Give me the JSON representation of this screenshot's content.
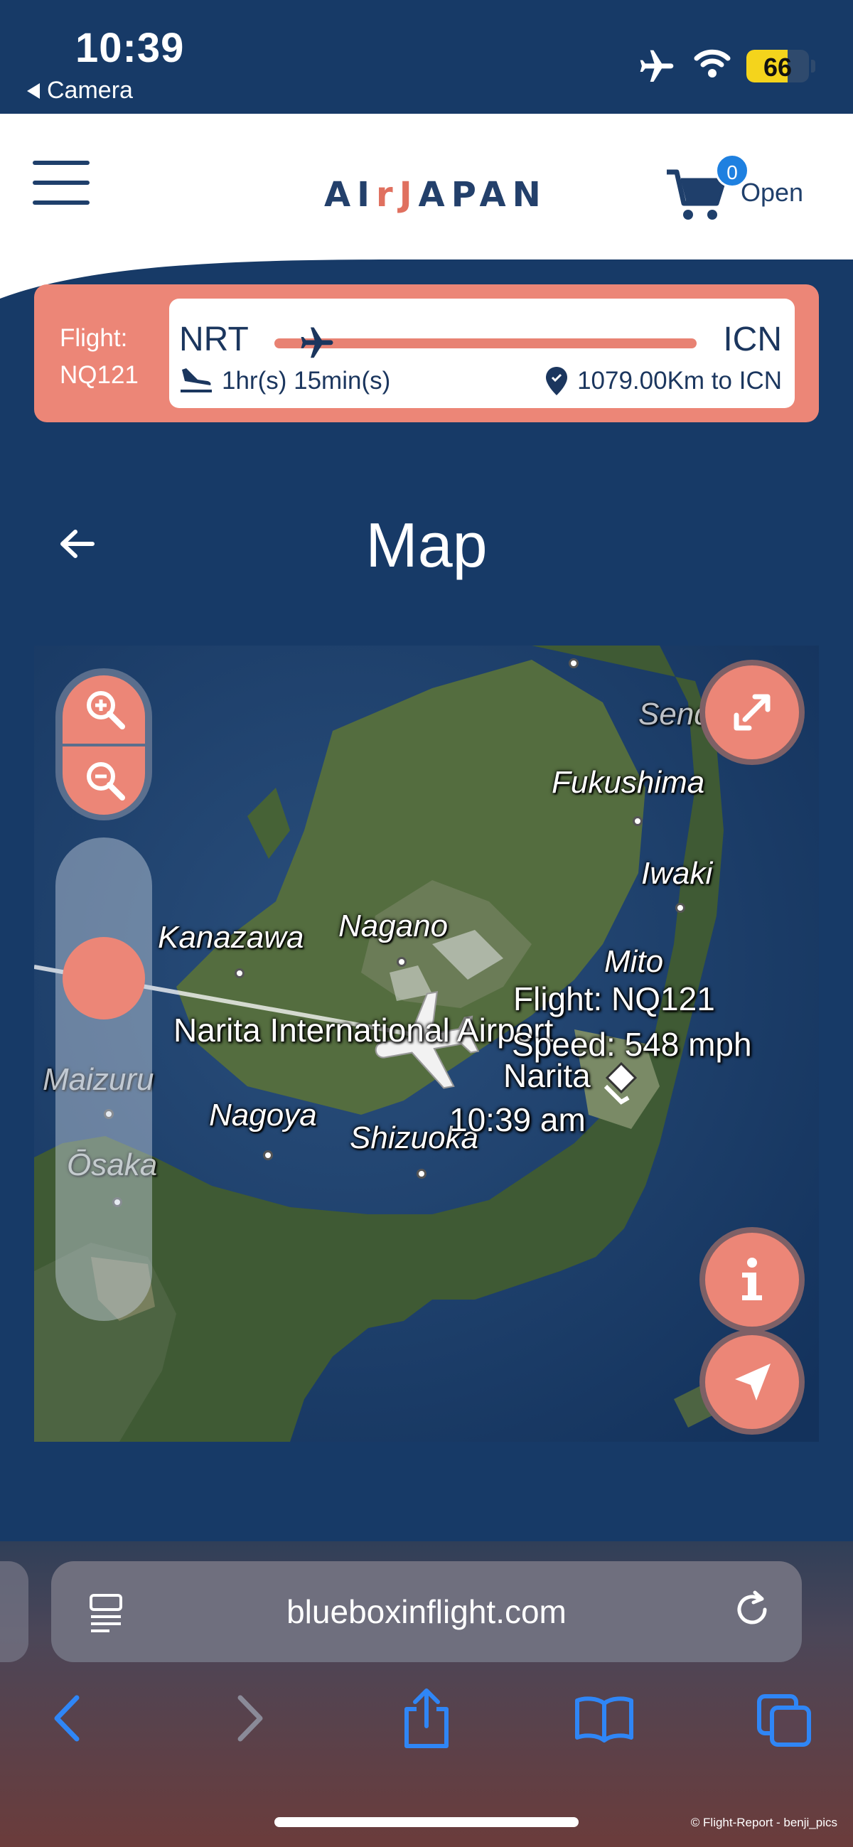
{
  "status_bar": {
    "time": "10:39",
    "back_app": "Camera",
    "battery": "66",
    "battery_level": 0.66,
    "icons": [
      "airplane-mode-icon",
      "wifi-icon",
      "battery-icon"
    ]
  },
  "header": {
    "logo_prefix": "AI",
    "logo_accent": "rJ",
    "logo_suffix": "APAN",
    "cart_count": "0",
    "cart_label": "Open"
  },
  "flight_progress": {
    "label_line1": "Flight:",
    "label_line2": "NQ121",
    "origin": "NRT",
    "destination": "ICN",
    "progress": 0.08,
    "time_remaining": "1hr(s) 15min(s)",
    "distance": "1079.00Km to ICN"
  },
  "page": {
    "title": "Map"
  },
  "map": {
    "place_labels": {
      "sendai": "Sendai",
      "fukushima": "Fukushima",
      "iwaki": "Iwaki",
      "mito": "Mito",
      "kanazawa": "Kanazawa",
      "nagano": "Nagano",
      "maizuru": "Maizuru",
      "nagoya": "Nagoya",
      "shizuoka": "Shizuoka",
      "osaka": "Ōsaka"
    },
    "airport_label": "Narita International Airport",
    "flight_info": {
      "flight": "Flight: NQ121",
      "speed": "Speed: 548 mph",
      "location": "Narita",
      "time": "10:39 am"
    }
  },
  "browser": {
    "url": "blueboxinflight.com"
  },
  "credit": "© Flight-Report - benji_pics",
  "colors": {
    "navy": "#173a67",
    "coral": "#ec8677",
    "text_dark": "#1b365e"
  }
}
